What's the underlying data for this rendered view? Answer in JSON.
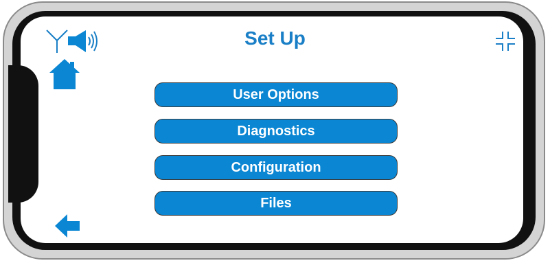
{
  "screen": {
    "title": "Set Up"
  },
  "menu": {
    "items": [
      {
        "label": "User Options"
      },
      {
        "label": "Diagnostics"
      },
      {
        "label": "Configuration"
      },
      {
        "label": "Files"
      }
    ]
  },
  "icons": {
    "antenna": "antenna-icon",
    "speaker": "speaker-icon",
    "home": "home-icon",
    "exit_fullscreen": "exit-fullscreen-icon",
    "back": "back-arrow-icon"
  },
  "colors": {
    "accent": "#0a86d3",
    "title": "#1a7fc6",
    "button_text": "#ffffff",
    "phone_frame": "#111111"
  }
}
